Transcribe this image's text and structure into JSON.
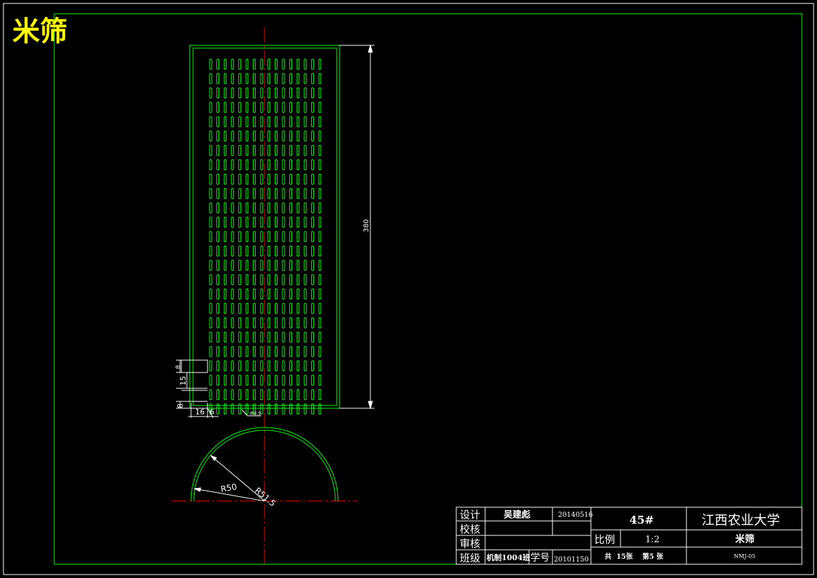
{
  "drawing_title": "米筛",
  "colors": {
    "background": "#000000",
    "border_outer": "#ffffff",
    "border_inner": "#00ff00",
    "part_lines": "#00ff00",
    "center_line": "#ff0000",
    "dimension": "#ffffff",
    "title_text": "#ffff00"
  },
  "dimensions": {
    "height": "380",
    "slot_len": "8",
    "pitch_v": "15",
    "gap": "8",
    "pitch_h": "16",
    "slot_w": "6",
    "corner_r": "R0.5",
    "r_inner": "R50",
    "r_outer": "R51.5"
  },
  "title_block": {
    "labels": {
      "design": "设计",
      "check": "校核",
      "review": "审核",
      "class": "班级",
      "student_no": "学号",
      "scale": "比例"
    },
    "designer": "吴建彪",
    "date": "20140516",
    "class_value": "机制1004班",
    "student_no_value": "20101150",
    "material": "45#",
    "school": "江西农业大学",
    "scale_value": "1:2",
    "part_name": "米筛",
    "sheet_info": "共  15张    第5 张",
    "drawing_no": "NMJ-05"
  }
}
